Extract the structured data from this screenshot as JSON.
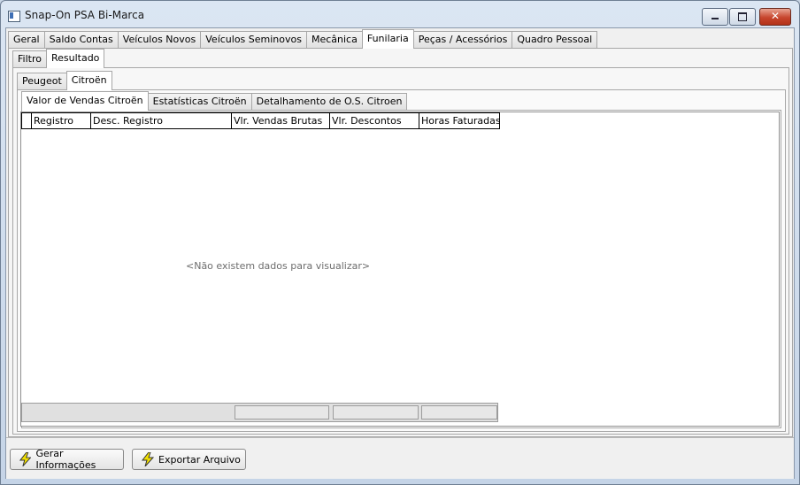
{
  "window": {
    "title": "Snap-On PSA Bi-Marca"
  },
  "main_tabs": [
    "Geral",
    "Saldo Contas",
    "Veículos Novos",
    "Veículos Seminovos",
    "Mecânica",
    "Funilaria",
    "Peças / Acessórios",
    "Quadro Pessoal"
  ],
  "main_tabs_active": "Funilaria",
  "sub_tabs": [
    "Filtro",
    "Resultado"
  ],
  "sub_tabs_active": "Resultado",
  "brand_tabs": [
    "Peugeot",
    "Citroën"
  ],
  "brand_tabs_active": "Citroën",
  "report_tabs": [
    "Valor de Vendas Citroën",
    "Estatísticas Citroën",
    "Detalhamento de O.S. Citroen"
  ],
  "report_tabs_active": "Valor de Vendas Citroën",
  "grid": {
    "columns": [
      "Registro",
      "Desc. Registro",
      "Vlr. Vendas Brutas",
      "Vlr. Descontos",
      "Horas Faturadas"
    ],
    "empty_message": "<Não existem dados para visualizar>"
  },
  "buttons": {
    "gerar": "Gerar Informações",
    "exportar": "Exportar Arquivo"
  },
  "icons": {
    "app": "window-icon",
    "button": "lightning-icon"
  },
  "colors": {
    "bolt": "#f2e000",
    "titlebar": "#c5d4e7",
    "close": "#c7452d"
  }
}
